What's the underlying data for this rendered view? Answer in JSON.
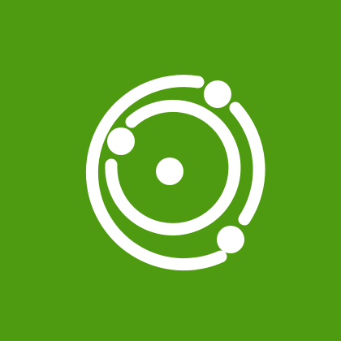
{
  "logo": {
    "icon": "orbit-icon",
    "background_color": "#4e9a10",
    "foreground_color": "#ffffff"
  }
}
